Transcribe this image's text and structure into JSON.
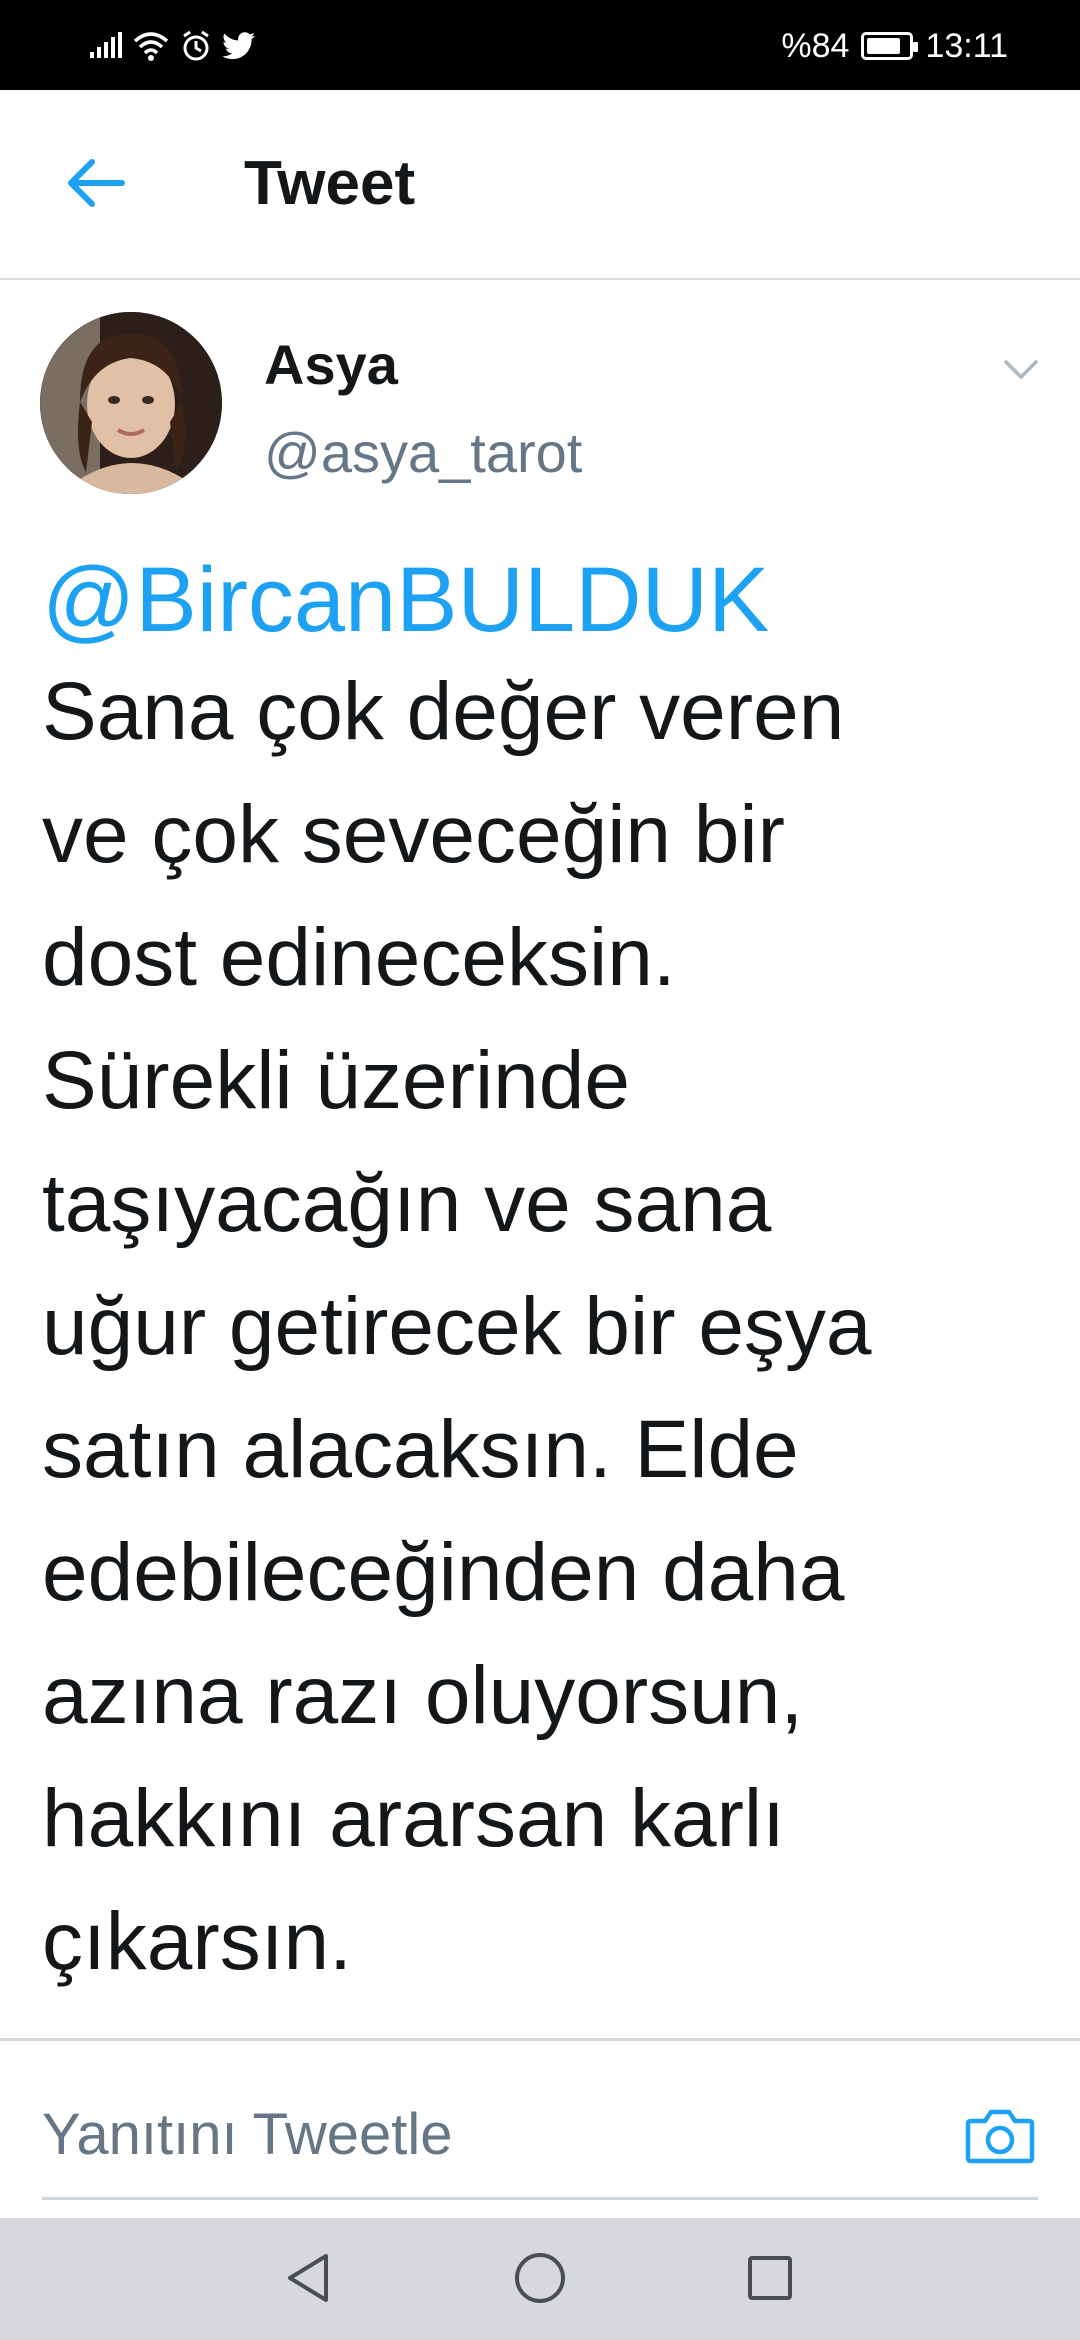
{
  "status_bar": {
    "battery_text": "%84",
    "battery_level": 0.84,
    "time": "13:11",
    "icons": [
      "signal-icon",
      "wifi-icon",
      "alarm-icon",
      "twitter-icon",
      "battery-icon"
    ]
  },
  "header": {
    "title": "Tweet",
    "back_icon": "back-arrow-icon"
  },
  "tweet": {
    "author_name": "Asya",
    "author_handle": "@asya_tarot",
    "mention": "@BircanBULDUK",
    "text_lines": [
      "Sana çok değer veren",
      "ve çok seveceğin bir",
      "dost edineceksin.",
      "Sürekli üzerinde",
      "taşıyacağın ve sana",
      "uğur getirecek bir eşya",
      "satın alacaksın. Elde",
      "edebileceğinden daha",
      "azına razı oluyorsun,",
      "hakkını ararsan karlı",
      "çıkarsın."
    ]
  },
  "reply": {
    "placeholder": "Yanıtını Tweetle",
    "camera_icon": "camera-icon"
  },
  "colors": {
    "accent": "#1da1f2",
    "text": "#14171a",
    "muted": "#657786"
  }
}
